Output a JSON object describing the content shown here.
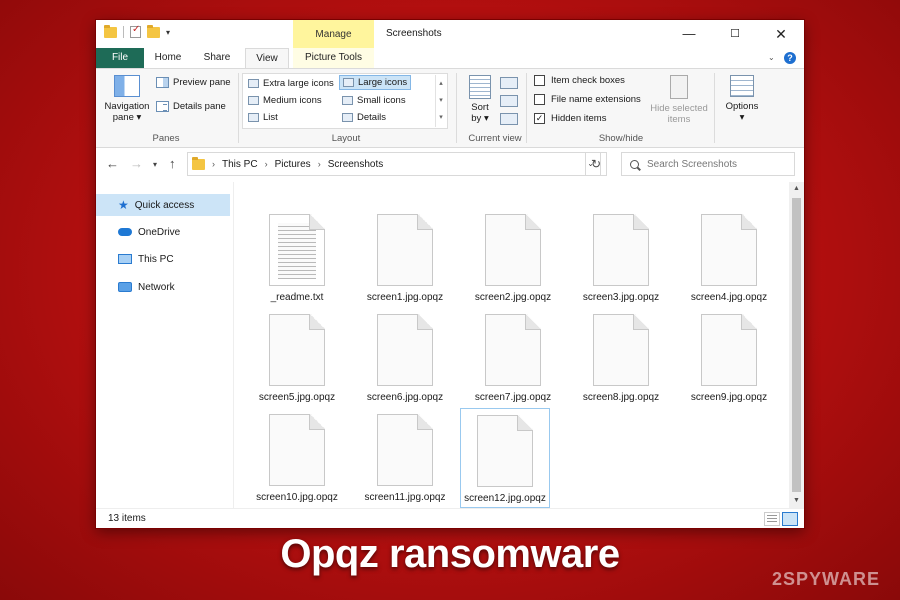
{
  "window": {
    "title": "Screenshots",
    "contextual_tab": "Manage",
    "buttons": {
      "minimize": "—",
      "maximize": "☐",
      "close": "✕"
    }
  },
  "ribbon_tabs": [
    "File",
    "Home",
    "Share",
    "View",
    "Picture Tools"
  ],
  "ribbon": {
    "panes": {
      "label": "Panes",
      "navigation_pane": "Navigation pane",
      "preview_pane": "Preview pane",
      "details_pane": "Details pane"
    },
    "layout": {
      "label": "Layout",
      "items": [
        "Extra large icons",
        "Large icons",
        "Medium icons",
        "Small icons",
        "List",
        "Details"
      ],
      "selected": "Large icons"
    },
    "current_view": {
      "label": "Current view",
      "sort_by": "Sort by"
    },
    "show_hide": {
      "label": "Show/hide",
      "item_check_boxes": {
        "label": "Item check boxes",
        "checked": false
      },
      "file_name_extensions": {
        "label": "File name extensions",
        "checked": false
      },
      "hidden_items": {
        "label": "Hidden items",
        "checked": true
      },
      "hide_selected": "Hide selected items"
    },
    "options": "Options"
  },
  "address": {
    "crumbs": [
      "This PC",
      "Pictures",
      "Screenshots"
    ],
    "search_placeholder": "Search Screenshots"
  },
  "sidebar": {
    "items": [
      {
        "label": "Quick access",
        "icon": "star-icon",
        "active": true
      },
      {
        "label": "OneDrive",
        "icon": "cloud-icon",
        "active": false
      },
      {
        "label": "This PC",
        "icon": "computer-icon",
        "active": false
      },
      {
        "label": "Network",
        "icon": "network-icon",
        "active": false
      }
    ]
  },
  "files": [
    {
      "name": "_readme.txt",
      "type": "text"
    },
    {
      "name": "screen1.jpg.opqz",
      "type": "blank"
    },
    {
      "name": "screen2.jpg.opqz",
      "type": "blank"
    },
    {
      "name": "screen3.jpg.opqz",
      "type": "blank"
    },
    {
      "name": "screen4.jpg.opqz",
      "type": "blank"
    },
    {
      "name": "screen5.jpg.opqz",
      "type": "blank"
    },
    {
      "name": "screen6.jpg.opqz",
      "type": "blank"
    },
    {
      "name": "screen7.jpg.opqz",
      "type": "blank"
    },
    {
      "name": "screen8.jpg.opqz",
      "type": "blank"
    },
    {
      "name": "screen9.jpg.opqz",
      "type": "blank"
    },
    {
      "name": "screen10.jpg.opqz",
      "type": "blank"
    },
    {
      "name": "screen11.jpg.opqz",
      "type": "blank"
    },
    {
      "name": "screen12.jpg.opqz",
      "type": "blank",
      "selected": true
    }
  ],
  "status": {
    "item_count": "13 items"
  },
  "caption": "Opqz ransomware",
  "watermark": "2SPYWARE",
  "colors": {
    "background": "#c41212",
    "file_tab": "#1e6b57",
    "manage_tab": "#fff59d",
    "selection": "#cce4f7"
  }
}
